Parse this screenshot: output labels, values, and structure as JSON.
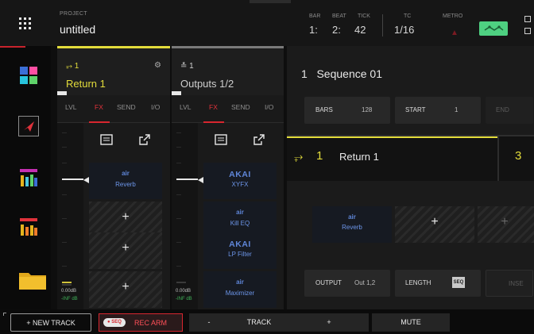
{
  "header": {
    "project_label": "PROJECT",
    "project_name": "untitled",
    "bar_label": "BAR",
    "beat_label": "BEAT",
    "tick_label": "TICK",
    "bar_value": "1:",
    "beat_value": "2:",
    "tick_value": "42",
    "tc_label": "TC",
    "tc_value": "1/16",
    "metro_label": "METRO"
  },
  "rail": {
    "icons": [
      "mixer-grid-icon",
      "send-arrow-icon",
      "channel-mixer-icon",
      "pad-mixer-icon",
      "folder-icon"
    ]
  },
  "tracks": [
    {
      "number": "1",
      "name": "Return 1",
      "selected": true,
      "tabs": [
        "LVL",
        "FX",
        "SEND",
        "I/O"
      ],
      "active_tab": "FX",
      "level_db": "0.00dB",
      "level_db2": "-INF dB",
      "slots": [
        {
          "type": "plugin",
          "brand": "air",
          "name": "Reverb"
        },
        {
          "type": "empty",
          "label": "+"
        },
        {
          "type": "empty",
          "label": "+"
        },
        {
          "type": "empty",
          "label": "+"
        }
      ]
    },
    {
      "number": "1",
      "name": "Outputs 1/2",
      "selected": false,
      "tabs": [
        "LVL",
        "FX",
        "SEND",
        "I/O"
      ],
      "active_tab": "FX",
      "level_db": "0.00dB",
      "level_db2": "-INF dB",
      "slots": [
        {
          "type": "plugin",
          "brand": "AKAI",
          "name": "XYFX"
        },
        {
          "type": "plugin",
          "brand": "air",
          "name": "Kill EQ"
        },
        {
          "type": "plugin",
          "brand": "AKAI",
          "name": "LP Filter"
        },
        {
          "type": "plugin",
          "brand": "air",
          "name": "Maximizer"
        }
      ]
    }
  ],
  "sequence": {
    "number": "1",
    "name": "Sequence 01",
    "bars_label": "BARS",
    "bars_value": "128",
    "start_label": "START",
    "start_value": "1",
    "end_label": "END"
  },
  "return_track": {
    "number": "1",
    "name": "Return 1",
    "count": "3",
    "slots": [
      {
        "type": "plugin",
        "brand": "air",
        "name": "Reverb"
      },
      {
        "type": "empty",
        "label": "+"
      },
      {
        "type": "empty",
        "label": "+"
      }
    ],
    "output_label": "OUTPUT",
    "output_value": "Out 1,2",
    "length_label": "LENGTH",
    "length_badge": "SEQ",
    "insert_label": "INSE"
  },
  "bottom": {
    "new_track": "+ NEW TRACK",
    "rec_tag": "● SEQ",
    "rec_arm": "REC ARM",
    "minus": "-",
    "track": "TRACK",
    "plus": "+",
    "mute": "MUTE"
  },
  "colors": {
    "accent_yellow": "#e3dc3b",
    "accent_red": "#d8262f",
    "plugin_blue": "#6d96ea",
    "thumb_green": "#4ed081"
  }
}
